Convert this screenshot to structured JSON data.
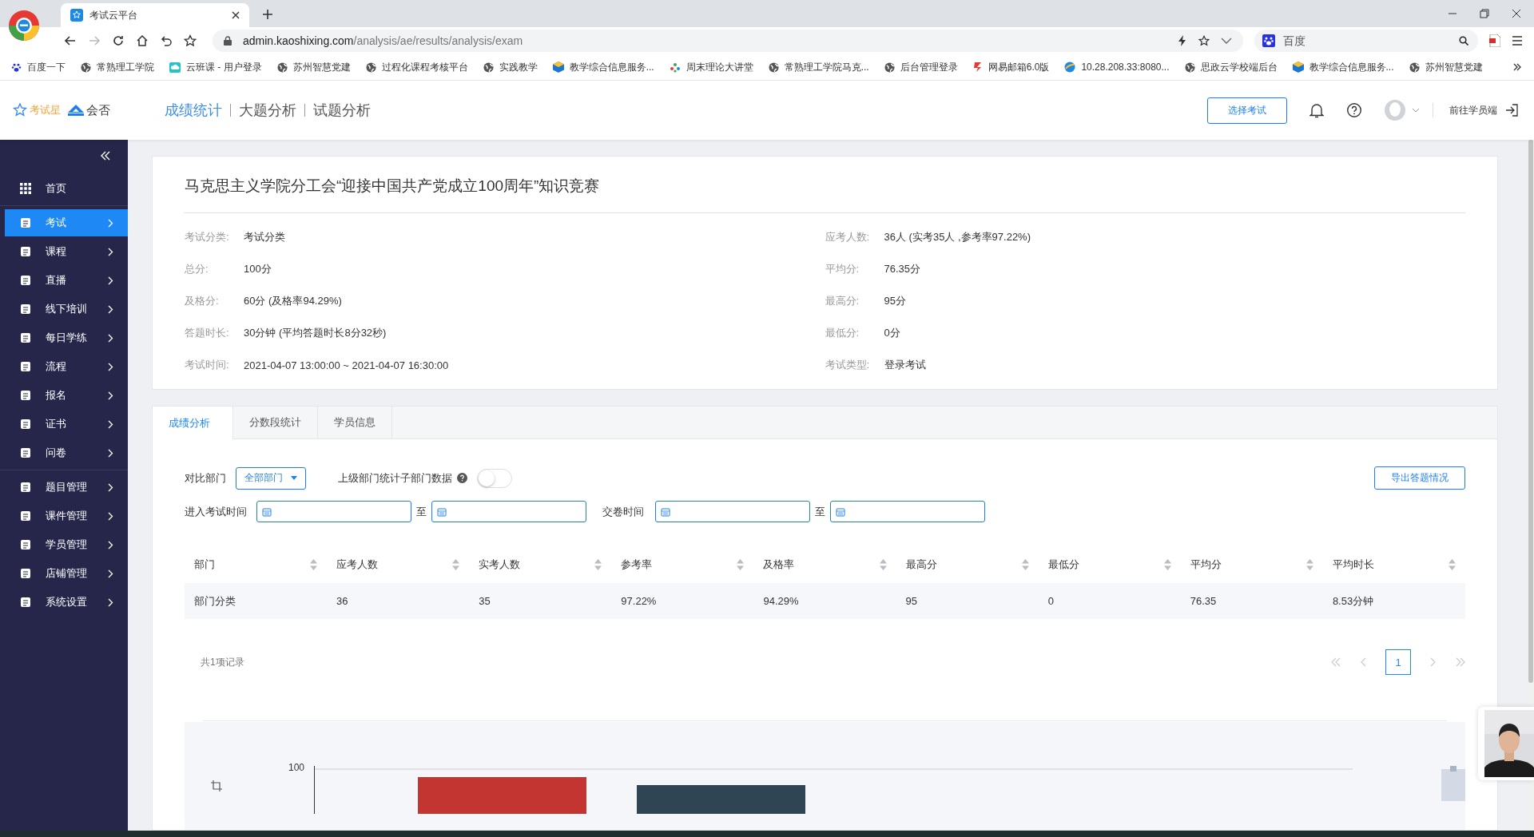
{
  "browser": {
    "tab_title": "考试云平台",
    "url_host": "admin.kaoshixing.com",
    "url_path": "/analysis/ae/results/analysis/exam",
    "search_placeholder": "百度",
    "bookmarks": [
      "百度一下",
      "常熟理工学院",
      "云班课 - 用户登录",
      "苏州智慧党建",
      "过程化课程考核平台",
      "实践教学",
      "教学综合信息服务...",
      "周末理论大讲堂",
      "常熟理工学院马克...",
      "后台管理登录",
      "网易邮箱6.0版",
      "10.28.208.33:8080...",
      "思政云学校端后台",
      "教学综合信息服务...",
      "苏州智慧党建"
    ]
  },
  "header": {
    "logo": "考试星",
    "logo_partner": "会否",
    "nav": [
      {
        "label": "成绩统计",
        "selected": true
      },
      {
        "label": "大题分析",
        "selected": false
      },
      {
        "label": "试题分析",
        "selected": false
      }
    ],
    "select_exam_button": "选择考试",
    "student_link": "前往学员端"
  },
  "sidebar": {
    "groups": [
      [
        {
          "label": "首页",
          "selected": false,
          "has_arrow": false
        }
      ],
      [
        {
          "label": "考试",
          "selected": true,
          "has_arrow": true
        },
        {
          "label": "课程",
          "selected": false,
          "has_arrow": true
        },
        {
          "label": "直播",
          "selected": false,
          "has_arrow": true
        },
        {
          "label": "线下培训",
          "selected": false,
          "has_arrow": true
        },
        {
          "label": "每日学练",
          "selected": false,
          "has_arrow": true
        },
        {
          "label": "流程",
          "selected": false,
          "has_arrow": true
        },
        {
          "label": "报名",
          "selected": false,
          "has_arrow": true
        },
        {
          "label": "证书",
          "selected": false,
          "has_arrow": true
        },
        {
          "label": "问卷",
          "selected": false,
          "has_arrow": true
        }
      ],
      [
        {
          "label": "题目管理",
          "selected": false,
          "has_arrow": true
        },
        {
          "label": "课件管理",
          "selected": false,
          "has_arrow": true
        },
        {
          "label": "学员管理",
          "selected": false,
          "has_arrow": true
        },
        {
          "label": "店铺管理",
          "selected": false,
          "has_arrow": true
        },
        {
          "label": "系统设置",
          "selected": false,
          "has_arrow": true
        }
      ]
    ]
  },
  "exam": {
    "title": "马克思主义学院分工会“迎接中国共产党成立100周年”知识竞赛",
    "left_fields": [
      {
        "label": "考试分类:",
        "value": "考试分类"
      },
      {
        "label": "总分:",
        "value": "100分"
      },
      {
        "label": "及格分:",
        "value": "60分 (及格率94.29%)"
      },
      {
        "label": "答题时长:",
        "value": "30分钟 (平均答题时长8分32秒)"
      },
      {
        "label": "考试时间:",
        "value": "2021-04-07 13:00:00 ~ 2021-04-07 16:30:00"
      }
    ],
    "right_fields": [
      {
        "label": "应考人数:",
        "value": "36人 (实考35人 ,参考率97.22%)"
      },
      {
        "label": "平均分:",
        "value": "76.35分"
      },
      {
        "label": "最高分:",
        "value": "95分"
      },
      {
        "label": "最低分:",
        "value": "0分"
      },
      {
        "label": "考试类型:",
        "value": "登录考试"
      }
    ]
  },
  "tabs": [
    {
      "label": "成绩分析",
      "selected": true
    },
    {
      "label": "分数段统计",
      "selected": false
    },
    {
      "label": "学员信息",
      "selected": false
    }
  ],
  "filters": {
    "department_label": "对比部门",
    "department_value": "全部部门",
    "sub_dept_label": "上级部门统计子部门数据",
    "sub_dept_toggle": {
      "on": false
    },
    "export_button": "导出答题情况",
    "enter_time_label": "进入考试时间",
    "enter_time_separator": "至",
    "submit_time_label": "交卷时间",
    "submit_time_separator": "至"
  },
  "table": {
    "columns": [
      "部门",
      "应考人数",
      "实考人数",
      "参考率",
      "及格率",
      "最高分",
      "最低分",
      "平均分",
      "平均时长"
    ],
    "rows": [
      [
        "部门分类",
        "36",
        "35",
        "97.22%",
        "94.29%",
        "95",
        "0",
        "76.35",
        "8.53分钟"
      ]
    ]
  },
  "pagination": {
    "total": "共1项记录",
    "pages": [
      {
        "label": "1",
        "selected": true
      }
    ]
  },
  "chart": {
    "tick_label": "100"
  }
}
